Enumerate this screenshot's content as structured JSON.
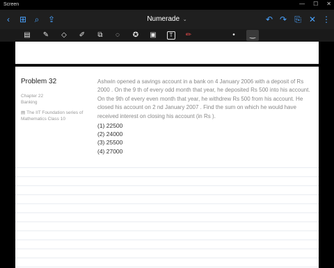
{
  "window": {
    "title": "Screen",
    "minimize": "—",
    "maximize": "☐",
    "close": "✕"
  },
  "app": {
    "title": "Numerade",
    "title_chevron": "⌄"
  },
  "appbar_icons": {
    "back": "‹",
    "grid": "⊞",
    "search": "⌕",
    "share": "⇪",
    "undo": "↶",
    "redo": "↷",
    "save": "⎘",
    "close": "✕",
    "more": "⋮"
  },
  "toolbar": {
    "panel": "▤",
    "pen": "✎",
    "eraser": "◇",
    "highlighter": "✐",
    "shapes": "⧉",
    "lasso": "◌",
    "sticker": "✪",
    "image": "▣",
    "text": "T",
    "laser": "✏",
    "dot": "•",
    "stroke": "‿"
  },
  "problem": {
    "title": "Problem 32",
    "chapter": "Chapter 22",
    "topic": "Banking",
    "book_line1": "The IIT Foundation series of",
    "book_line2": "Mathematics Class 10",
    "question": "Ashwin opened a savings account in a bank on 4 January 2006 with a deposit of Rs 2000 . On the 9 th of every odd month that year, he deposited Rs 500 into his account. On the 9th of every even month that year, he withdrew Rs 500 from his account. He closed his account on 2 nd January 2007 . Find the sum on which he would have received interest on closing his account (in Rs ).",
    "options": [
      "(1) 22500",
      "(2) 24000",
      "(3) 25500",
      "(4) 27000"
    ]
  },
  "colors": {
    "accent": "#4aa3ff",
    "appbar": "#1f1f1f",
    "toolbar": "#1a1a1a",
    "laser_red": "#e04848"
  }
}
